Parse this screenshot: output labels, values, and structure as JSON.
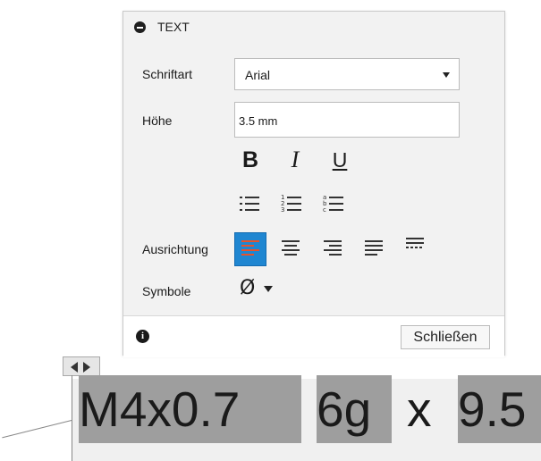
{
  "panel": {
    "title": "TEXT",
    "font_label": "Schriftart",
    "font_value": "Arial",
    "height_label": "Höhe",
    "height_value": "3.5 mm",
    "format_buttons": {
      "bold": "B",
      "italic": "I",
      "underline": "U"
    },
    "alignment_label": "Ausrichtung",
    "symbols_label": "Symbole",
    "symbol_value": "Ø",
    "close_label": "Schließen"
  },
  "canvas": {
    "text_segments": [
      "M4x0.7",
      "6g",
      "x",
      "9.5"
    ]
  },
  "colors": {
    "accent": "#1f86d1",
    "panel_bg": "#f2f2f2",
    "selection_bg": "#9e9e9e"
  }
}
